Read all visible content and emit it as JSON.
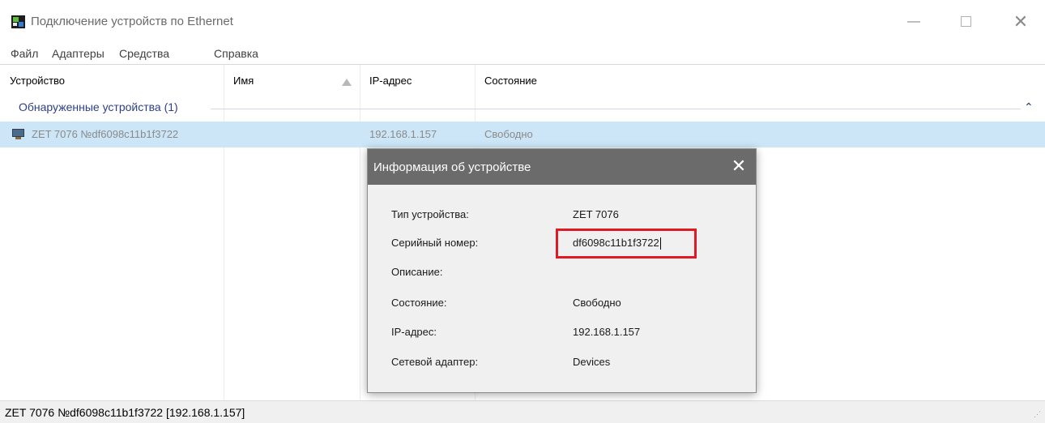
{
  "window": {
    "title": "Подключение устройств по Ethernet",
    "minimize_glyph": "—",
    "close_glyph": "✕"
  },
  "menu": {
    "items": [
      "Файл",
      "Адаптеры",
      "Средства",
      "Справка"
    ]
  },
  "list": {
    "columns": [
      "Устройство",
      "Имя",
      "IP-адрес",
      "Состояние"
    ],
    "sort_column": "Имя",
    "group": {
      "label": "Обнаруженные устройства (1)",
      "collapse_glyph": "⌃"
    },
    "rows": [
      {
        "device": "ZET 7076 №df6098c11b1f3722",
        "name": "",
        "ip": "192.168.1.157",
        "state": "Свободно",
        "icon": "network-pc-icon",
        "selected": true
      }
    ]
  },
  "dialog": {
    "title": "Информация об устройстве",
    "close_glyph": "✕",
    "fields": [
      {
        "label": "Тип устройства:",
        "value": "ZET 7076"
      },
      {
        "label": "Серийный номер:",
        "value": "df6098c11b1f3722"
      },
      {
        "label": "Описание:",
        "value": ""
      },
      {
        "label": "Состояние:",
        "value": "Свободно"
      },
      {
        "label": "IP-адрес:",
        "value": "192.168.1.157"
      },
      {
        "label": "Сетевой адаптер:",
        "value": "Devices"
      }
    ]
  },
  "status": {
    "text": "ZET 7076 №df6098c11b1f3722 [192.168.1.157]",
    "grip_glyph": "⋰"
  },
  "colors": {
    "selection": "#cce6f7",
    "group_text": "#2e3f86",
    "dialog_title_bg": "#6b6b6b",
    "highlight": "#e01a24"
  }
}
